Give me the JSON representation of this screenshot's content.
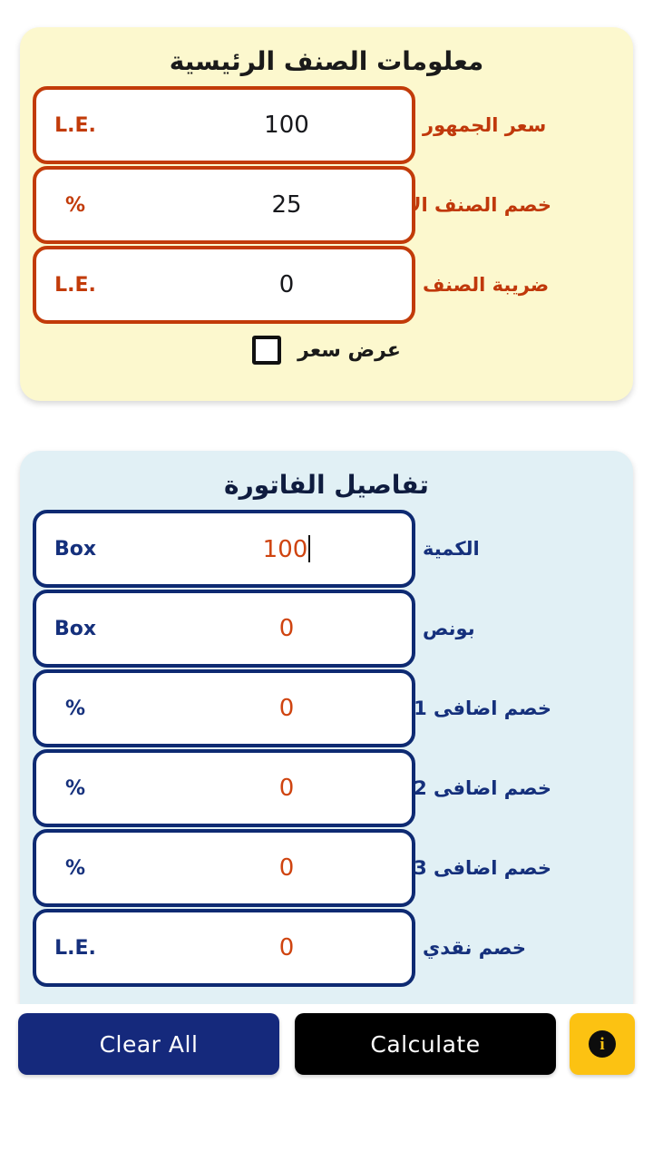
{
  "main_card": {
    "title": "معلومات الصنف الرئيسية",
    "bg_color": "#FCF8CE",
    "accent_color": "#C23B09",
    "fields": [
      {
        "label": "سعر الجمهور",
        "value": "100",
        "unit": "L.E."
      },
      {
        "label": "خصم الصنف الاساسي",
        "value": "25",
        "unit": "%"
      },
      {
        "label": "ضريبة الصنف",
        "value": "0",
        "unit": "L.E."
      }
    ],
    "checkbox": {
      "label": "عرض سعر",
      "checked": "false"
    }
  },
  "invoice_card": {
    "title": "تفاصيل الفاتورة",
    "bg_color": "#E1F0F5",
    "accent_color": "#0E2A72",
    "fields": [
      {
        "label": "الكمية",
        "value": "100",
        "unit": "Box",
        "focused": "true"
      },
      {
        "label": "بونص",
        "value": "0",
        "unit": "Box"
      },
      {
        "label": "خصم اضافى 1",
        "value": "0",
        "unit": "%"
      },
      {
        "label": "خصم اضافى 2",
        "value": "0",
        "unit": "%"
      },
      {
        "label": "خصم اضافى 3",
        "value": "0",
        "unit": "%"
      },
      {
        "label": "خصم نقدي",
        "value": "0",
        "unit": "L.E."
      }
    ]
  },
  "button_bar": {
    "clear_all_label": "Clear All",
    "clear_all_color": "#15297C",
    "calculate_label": "Calculate",
    "calculate_color": "#000000",
    "info_label": "i",
    "info_color": "#FCC212"
  }
}
